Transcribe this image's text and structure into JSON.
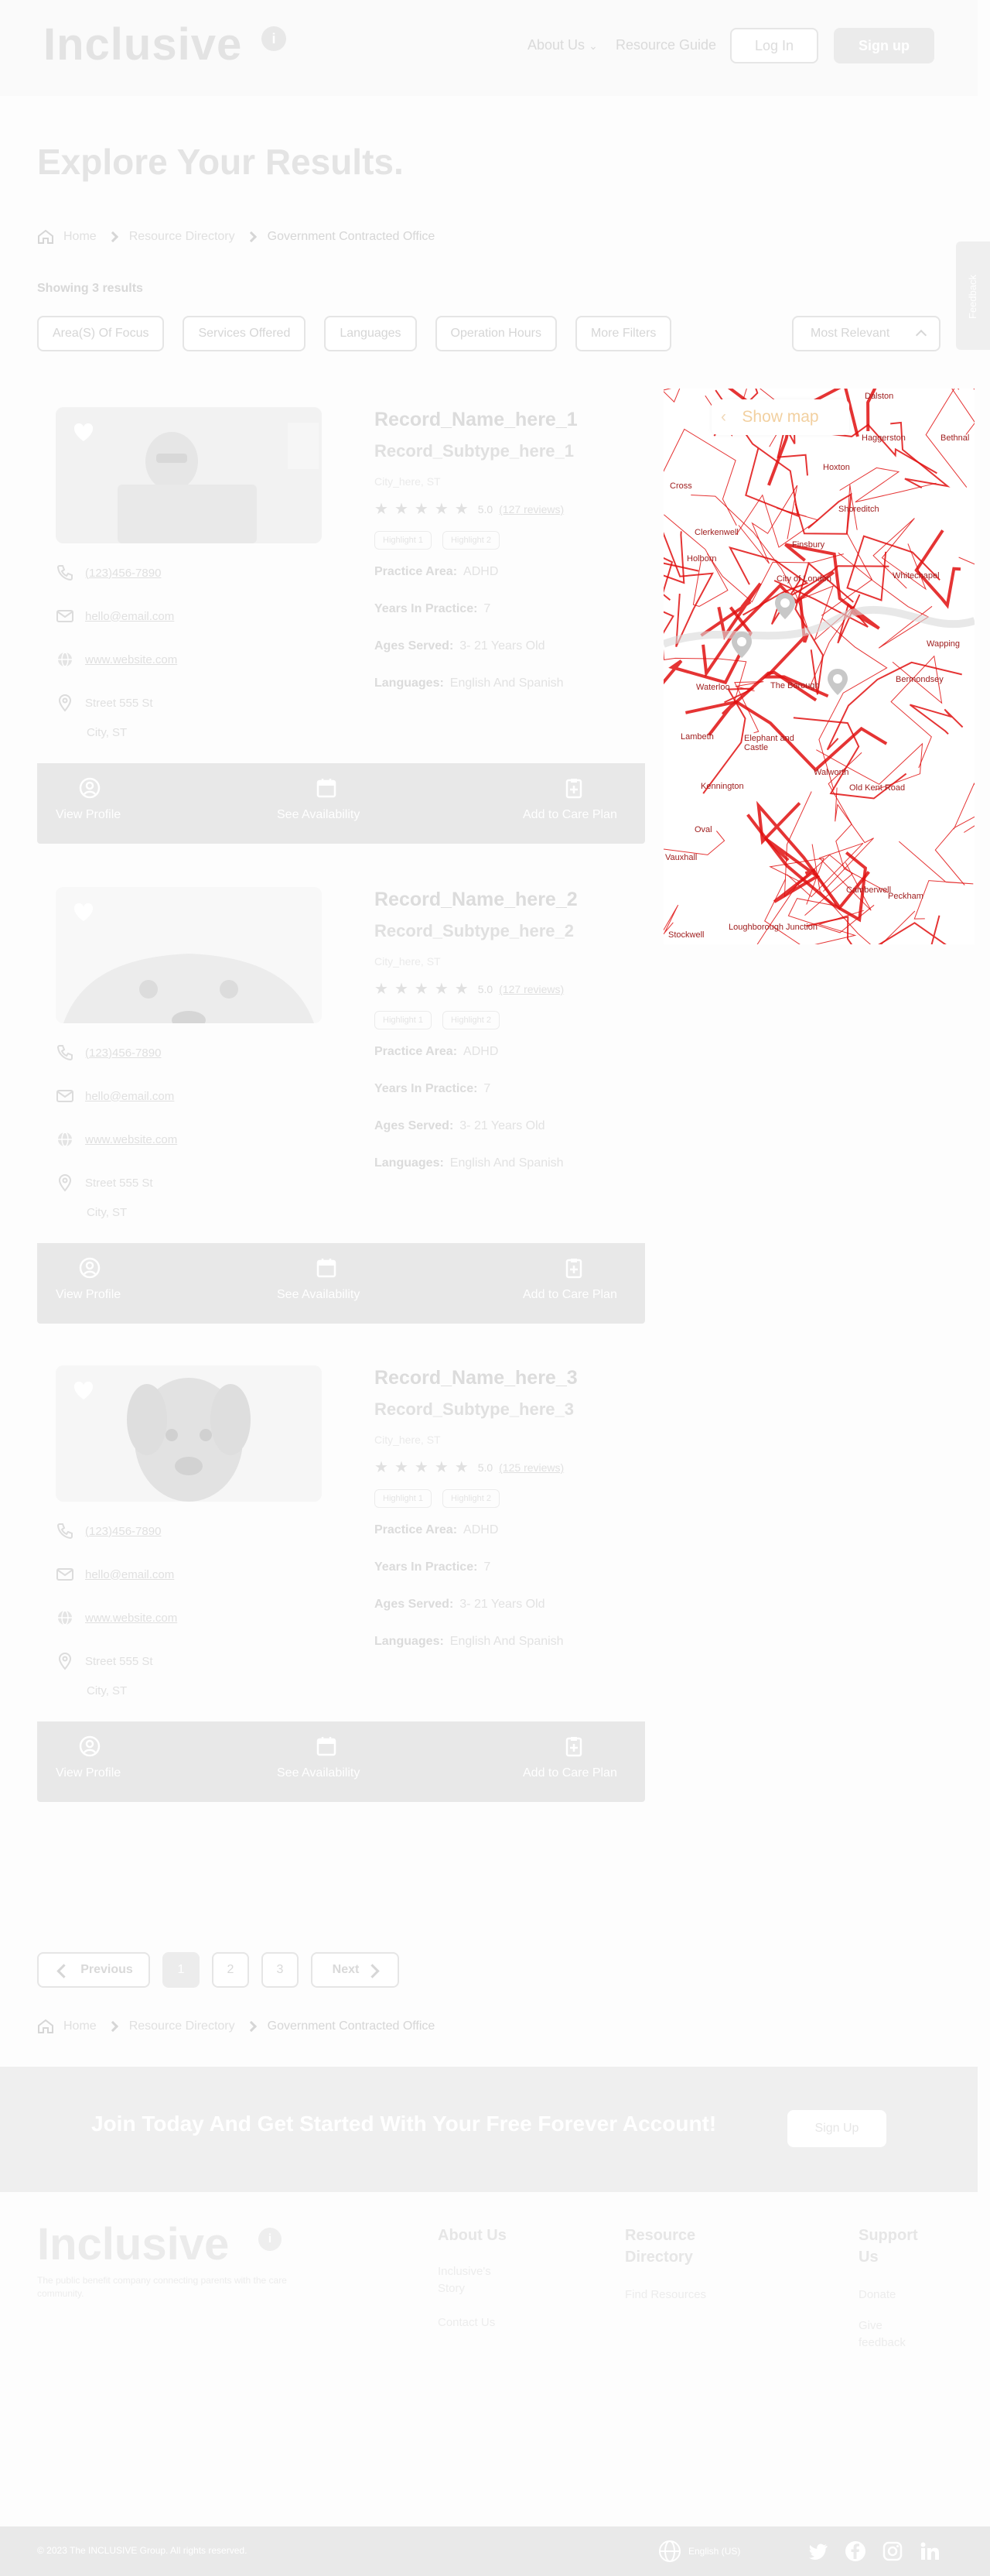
{
  "header": {
    "logo": "Inclusive",
    "nav": {
      "about": "About Us",
      "resource_guide": "Resource Guide"
    },
    "login": "Log In",
    "signup": "Sign up"
  },
  "feedback_tab": "Feedback",
  "page_title": "Explore Your Results.",
  "breadcrumb": {
    "home": "Home",
    "directory": "Resource Directory",
    "current": "Government Contracted Office"
  },
  "showing": "Showing 3 results",
  "filters": [
    "Area(S) Of Focus",
    "Services Offered",
    "Languages",
    "Operation Hours",
    "More Filters"
  ],
  "sort": "Most Relevant",
  "labels": {
    "practice_area": "Practice Area:",
    "years": "Years In Practice:",
    "ages": "Ages Served:",
    "languages": "Languages:",
    "view_profile": "View Profile",
    "see_availability": "See Availability",
    "add_care_plan": "Add to Care Plan"
  },
  "cards": [
    {
      "name": "Record_Name_here_1",
      "subtype": "Record_Subtype_here_1",
      "city": "City_here, ST",
      "rating": "5.0",
      "reviews": "(127 reviews)",
      "highlights": [
        "Highlight 1",
        "Highlight 2"
      ],
      "practice_area": "ADHD",
      "years": "7",
      "ages": "3- 21 Years Old",
      "languages": "English And Spanish",
      "phone": "(123)456-7890",
      "email": "hello@email.com",
      "website": "www.website.com",
      "street": "Street 555 St",
      "city_line": "City, ST"
    },
    {
      "name": "Record_Name_here_2",
      "subtype": "Record_Subtype_here_2",
      "city": "City_here, ST",
      "rating": "5.0",
      "reviews": "(127 reviews)",
      "highlights": [
        "Highlight 1",
        "Highlight 2"
      ],
      "practice_area": "ADHD",
      "years": "7",
      "ages": "3- 21 Years Old",
      "languages": "English And Spanish",
      "phone": "(123)456-7890",
      "email": "hello@email.com",
      "website": "www.website.com",
      "street": "Street 555 St",
      "city_line": "City, ST"
    },
    {
      "name": "Record_Name_here_3",
      "subtype": "Record_Subtype_here_3",
      "city": "City_here, ST",
      "rating": "5.0",
      "reviews": "(125 reviews)",
      "highlights": [
        "Highlight 1",
        "Highlight 2"
      ],
      "practice_area": "ADHD",
      "years": "7",
      "ages": "3- 21 Years Old",
      "languages": "English And Spanish",
      "phone": "(123)456-7890",
      "email": "hello@email.com",
      "website": "www.website.com",
      "street": "Street 555 St",
      "city_line": "City, ST"
    }
  ],
  "map": {
    "button": "Show map",
    "places": [
      "Dalston",
      "Haggerston",
      "Hoxton",
      "Shoreditch",
      "Bethnal",
      "Clerkenwell",
      "Finsbury",
      "City of London",
      "Whitechapel",
      "Holborn",
      "Wapping",
      "Waterloo",
      "The Borough",
      "Bermondsey",
      "Lambeth",
      "Elephant and Castle",
      "Kennington",
      "Walworth",
      "Old Kent Road",
      "Oval",
      "Camberwell",
      "Peckham",
      "Stockwell",
      "Loughborough Junction",
      "Cross",
      "Vauxhall"
    ]
  },
  "pagination": {
    "prev": "Previous",
    "pages": [
      "1",
      "2",
      "3"
    ],
    "next": "Next"
  },
  "cta": {
    "text": "Join Today And Get Started With Your Free Forever Account!",
    "button": "Sign Up"
  },
  "footer": {
    "logo": "Inclusive",
    "tagline": "The public benefit company connecting parents with the care community.",
    "about_title": "About Us",
    "about_links": [
      "Inclusive's Story",
      "Contact Us"
    ],
    "resource_title": "Resource Directory",
    "resource_links": [
      "Find Resources"
    ],
    "support_title": "Support Us",
    "support_links": [
      "Donate",
      "Give feedback"
    ],
    "copyright": "© 2023 The INCLUSIVE Group. All rights reserved.",
    "language": "English (US)"
  },
  "colors": {
    "map_roads": "#e01010",
    "placeholder_grey": "#e6e6e6",
    "accent_orange": "#f2d0a0"
  }
}
